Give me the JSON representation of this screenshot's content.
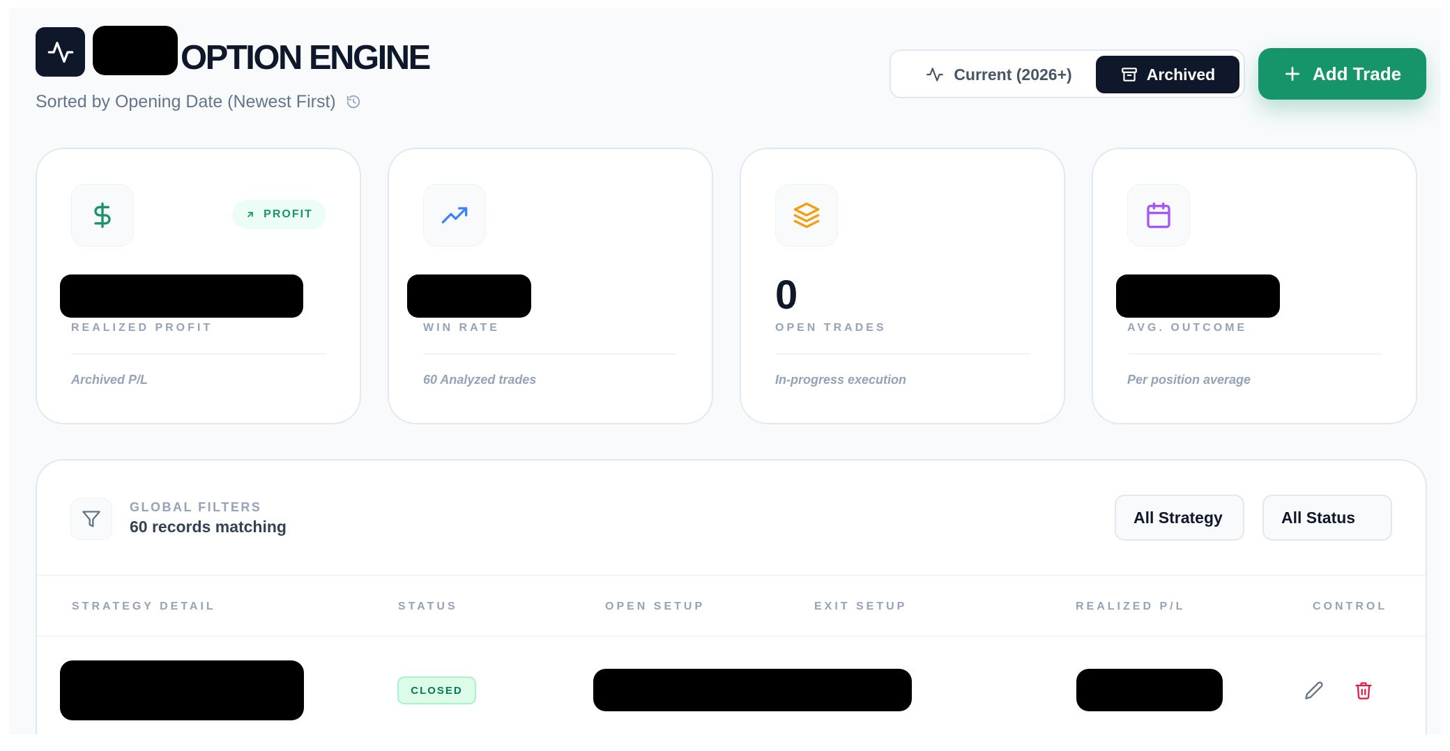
{
  "header": {
    "title": "OPTION ENGINE",
    "subtitle": "Sorted by Opening Date (Newest First)",
    "icons": {
      "logo": "activity-pulse-icon",
      "sort": "history-icon"
    }
  },
  "view_toggle": {
    "current_label": "Current (2026+)",
    "archived_label": "Archived",
    "selected": "Archived"
  },
  "actions": {
    "add_trade_label": "Add Trade"
  },
  "kpis": [
    {
      "icon": "dollar-icon",
      "icon_color": "#16956a",
      "badge": "PROFIT",
      "label": "REALIZED PROFIT",
      "footnote": "Archived P/L"
    },
    {
      "icon": "trending-up-icon",
      "icon_color": "#3b82f6",
      "label": "WIN RATE",
      "footnote": "60 Analyzed trades"
    },
    {
      "icon": "layers-icon",
      "icon_color": "#f59e0b",
      "value": "0",
      "label": "OPEN TRADES",
      "footnote": "In-progress execution"
    },
    {
      "icon": "calendar-icon",
      "icon_color": "#a855f7",
      "label": "AVG. OUTCOME",
      "footnote": "Per position average"
    }
  ],
  "filters": {
    "title": "GLOBAL FILTERS",
    "count_text": "60 records matching",
    "strategy_select": "All Strategy",
    "status_select": "All Status"
  },
  "table": {
    "columns": [
      "STRATEGY DETAIL",
      "STATUS",
      "OPEN SETUP",
      "EXIT SETUP",
      "REALIZED P/L",
      "CONTROL"
    ],
    "rows": [
      {
        "status": "CLOSED"
      }
    ]
  },
  "colors": {
    "dark": "#0f172a",
    "accent_green": "#16956a",
    "delete_red": "#e11d48",
    "muted": "#94a3b8"
  }
}
